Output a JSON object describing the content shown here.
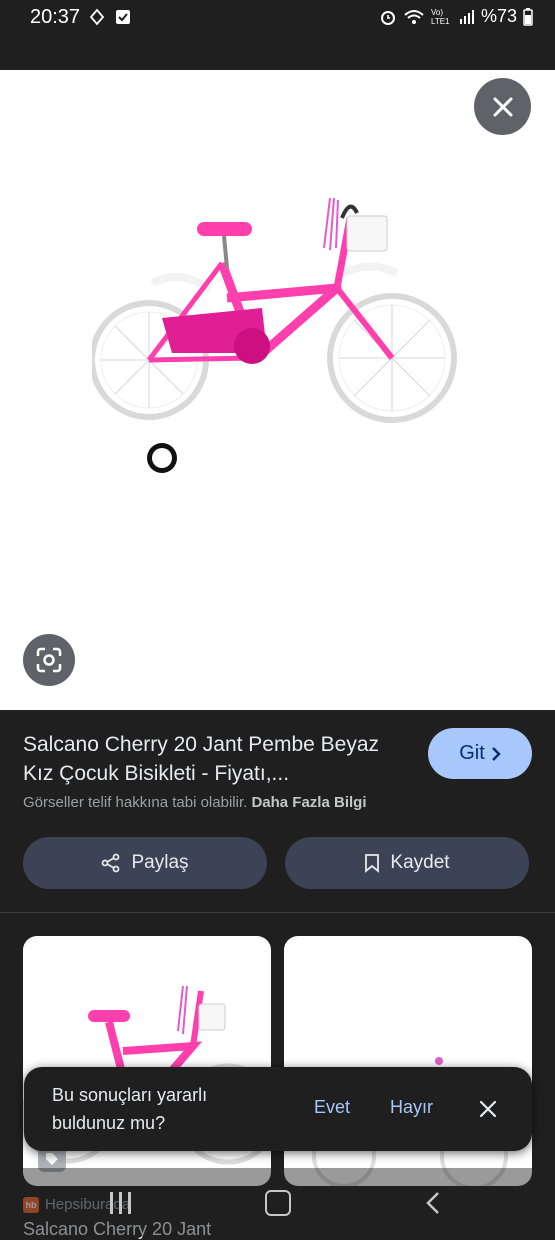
{
  "status_bar": {
    "time": "20:37",
    "network_label": "Vo) LTE1",
    "battery": "%73"
  },
  "image_viewer": {
    "close_icon": "close-icon",
    "lens_icon": "google-lens-icon"
  },
  "result": {
    "title": "Salcano Cherry 20 Jant Pembe Beyaz Kız Çocuk Bisikleti - Fiyatı,...",
    "visit_label": "Git",
    "copyright_text": "Görseller telif hakkına tabi olabilir.",
    "more_info_label": "Daha Fazla Bilgi",
    "share_label": "Paylaş",
    "save_label": "Kaydet"
  },
  "related": {
    "source": "Hepsiburada",
    "favicon_text": "hb",
    "title": "Salcano Cherry 20 Jant"
  },
  "feedback": {
    "question": "Bu sonuçları yararlı buldunuz mu?",
    "yes_label": "Evet",
    "no_label": "Hayır"
  },
  "colors": {
    "accent": "#a8c7fa",
    "bike_pink": "#ff3fae",
    "background": "#1f1f1f"
  }
}
